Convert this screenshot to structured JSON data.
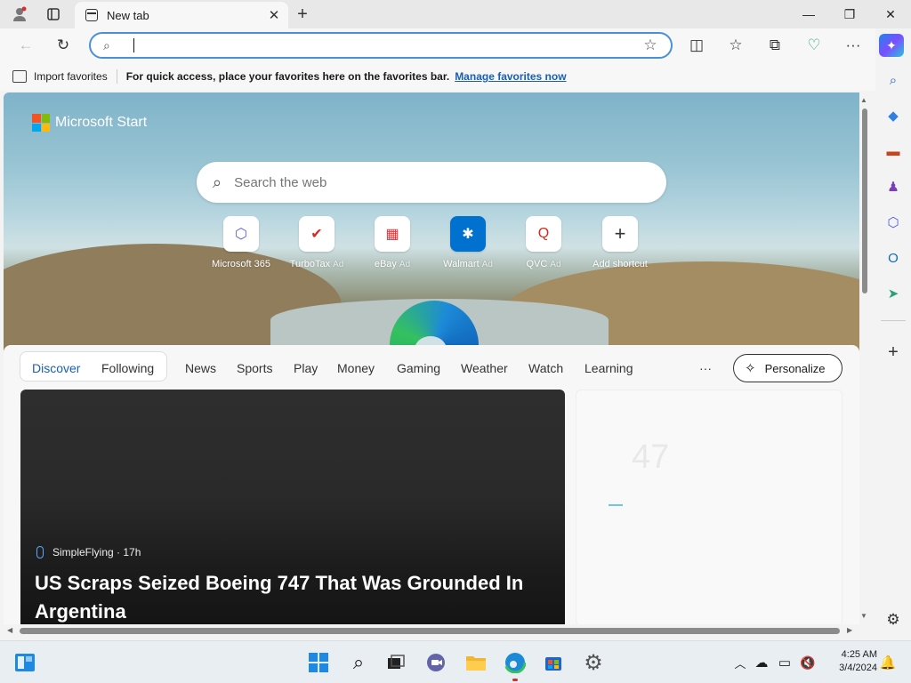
{
  "browser": {
    "tab": {
      "title": "New tab",
      "close_glyph": "✕"
    },
    "new_tab_glyph": "+",
    "window_controls": {
      "minimize": "—",
      "maximize": "❐",
      "close": "✕"
    },
    "nav": {
      "back": "←",
      "refresh": "↻"
    },
    "address": {
      "value": "",
      "placeholder": ""
    },
    "toolbar_glyphs": {
      "split": "◫",
      "favorites": "☆",
      "collections": "⧉",
      "performance": "♡",
      "more": "···"
    }
  },
  "favorites_bar": {
    "import_label": "Import favorites",
    "hint": "For quick access, place your favorites here on the favorites bar.",
    "manage_link": "Manage favorites now"
  },
  "sidebar": {
    "items": [
      {
        "name": "search-icon",
        "glyph": "⌕",
        "color": "#1a5fb4"
      },
      {
        "name": "shopping-icon",
        "glyph": "◆",
        "color": "#2f7fe0"
      },
      {
        "name": "tools-icon",
        "glyph": "▬",
        "color": "#c8431c"
      },
      {
        "name": "games-icon",
        "glyph": "♟",
        "color": "#7a3fb8"
      },
      {
        "name": "microsoft365-icon",
        "glyph": "⬡",
        "color": "#4b5be0"
      },
      {
        "name": "outlook-icon",
        "glyph": "O",
        "color": "#0f6cbd"
      },
      {
        "name": "send-icon",
        "glyph": "➤",
        "color": "#2aa17a"
      },
      {
        "name": "add-icon",
        "glyph": "+",
        "color": "#333333"
      },
      {
        "name": "settings-icon",
        "glyph": "⚙",
        "color": "#333333"
      }
    ]
  },
  "newtab": {
    "brand": "Microsoft Start",
    "search_placeholder": "Search the web",
    "shortcuts": [
      {
        "label": "Microsoft 365",
        "ad": "",
        "glyph": "⬡",
        "color": "#5a5fe0"
      },
      {
        "label": "TurboTax",
        "ad": "Ad",
        "glyph": "✔",
        "color": "#d52b1e"
      },
      {
        "label": "eBay",
        "ad": "Ad",
        "glyph": "▦",
        "color": "#e53238"
      },
      {
        "label": "Walmart",
        "ad": "Ad",
        "glyph": "✱",
        "color": "#0071ce"
      },
      {
        "label": "QVC",
        "ad": "Ad",
        "glyph": "Q",
        "color": "#d52b1e"
      },
      {
        "label": "Add shortcut",
        "ad": "",
        "glyph": "+",
        "color": "#333333"
      }
    ]
  },
  "feed": {
    "nav": [
      "Discover",
      "Following",
      "News",
      "Sports",
      "Play",
      "Money",
      "Gaming",
      "Weather",
      "Watch",
      "Learning"
    ],
    "more": "···",
    "personalize": "Personalize",
    "article": {
      "source": "SimpleFlying · 17h",
      "headline": "US Scraps Seized Boeing 747 That Was Grounded In Argentina"
    },
    "weather": {
      "temp": "47"
    }
  },
  "taskbar": {
    "time": "4:25 AM",
    "date": "3/4/2024"
  },
  "colors": {
    "accent": "#1a5fb4",
    "address_border": "#4a90d9"
  }
}
